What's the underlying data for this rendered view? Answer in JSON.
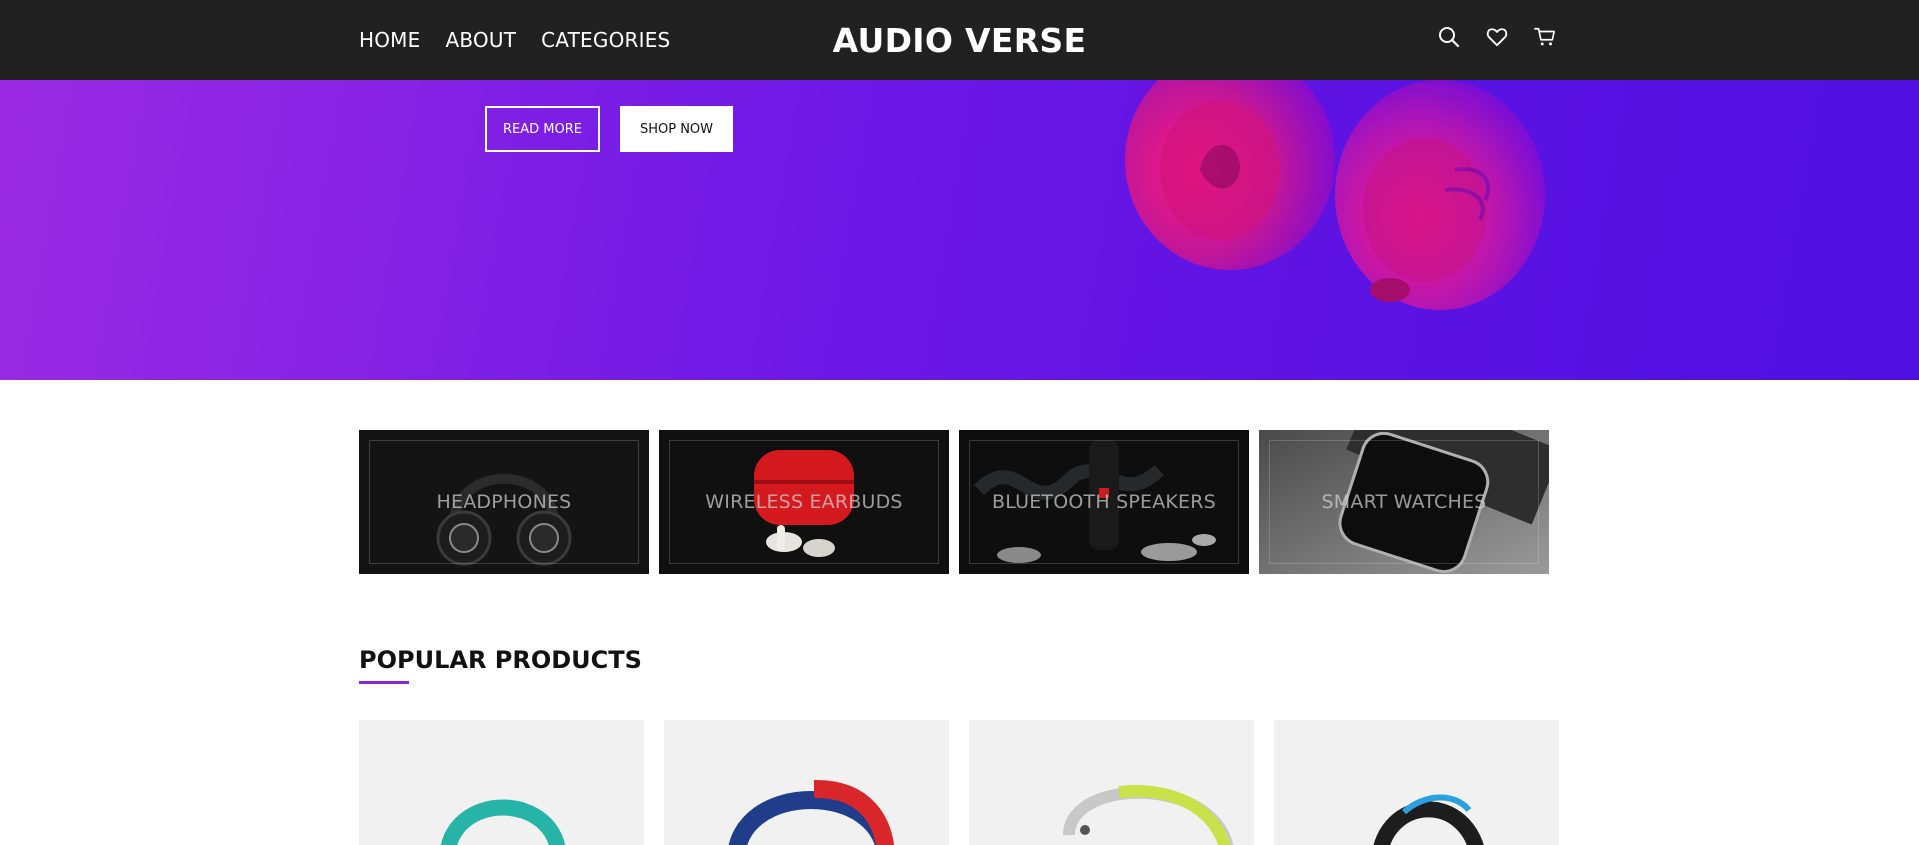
{
  "header": {
    "nav": [
      "HOME",
      "ABOUT",
      "CATEGORIES"
    ],
    "logo": "AUDIO VERSE",
    "icons": [
      "search-icon",
      "heart-icon",
      "cart-icon"
    ]
  },
  "hero": {
    "read_more": "READ MORE",
    "shop_now": "SHOP NOW",
    "gradient": [
      "#9b2be3",
      "#4f0fe0"
    ]
  },
  "categories": [
    {
      "label": "HEADPHONES"
    },
    {
      "label": "WIRELESS EARBUDS"
    },
    {
      "label": "BLUETOOTH SPEAKERS"
    },
    {
      "label": "SMART WATCHES"
    }
  ],
  "popular": {
    "title": "POPULAR PRODUCTS",
    "accent": "#8a26d9",
    "products": [
      {
        "color": "#26b3a8"
      },
      {
        "color": "#d8262b"
      },
      {
        "color": "#c9e24a"
      },
      {
        "color": "#2aa0e0"
      }
    ]
  }
}
